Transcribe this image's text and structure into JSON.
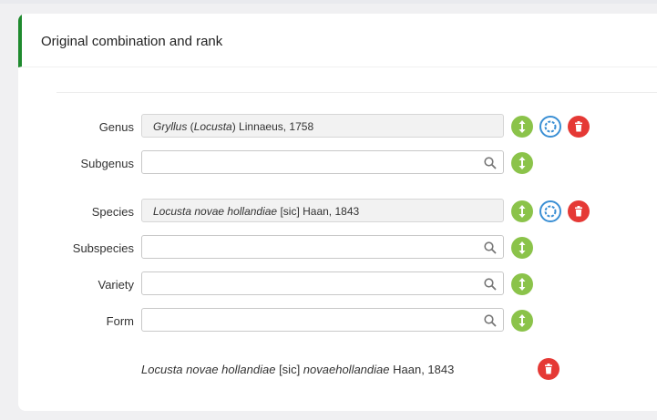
{
  "section": {
    "title": "Original combination and rank"
  },
  "fields": {
    "genus": {
      "label": "Genus",
      "value_italic_1": "Gryllus",
      "value_plain_1": " (",
      "value_italic_2": "Locusta",
      "value_plain_2": ") Linnaeus, 1758"
    },
    "subgenus": {
      "label": "Subgenus",
      "value": ""
    },
    "species": {
      "label": "Species",
      "value_italic": "Locusta novae hollandiae",
      "value_plain": " [sic] Haan, 1843"
    },
    "subspecies": {
      "label": "Subspecies",
      "value": ""
    },
    "variety": {
      "label": "Variety",
      "value": ""
    },
    "form": {
      "label": "Form",
      "value": ""
    }
  },
  "result": {
    "italic_1": "Locusta novae hollandiae",
    "plain_1": " [sic] ",
    "italic_2": "novaehollandiae",
    "plain_2": " Haan, 1843"
  },
  "icons": {
    "move": "up-down-arrows-icon",
    "change": "refresh-icon",
    "delete": "trash-icon",
    "search": "search-icon"
  },
  "colors": {
    "accent": "#1f8a2e",
    "move_button": "#8bc34a",
    "delete_button": "#e53935",
    "change_button": "#3a8fd4"
  }
}
